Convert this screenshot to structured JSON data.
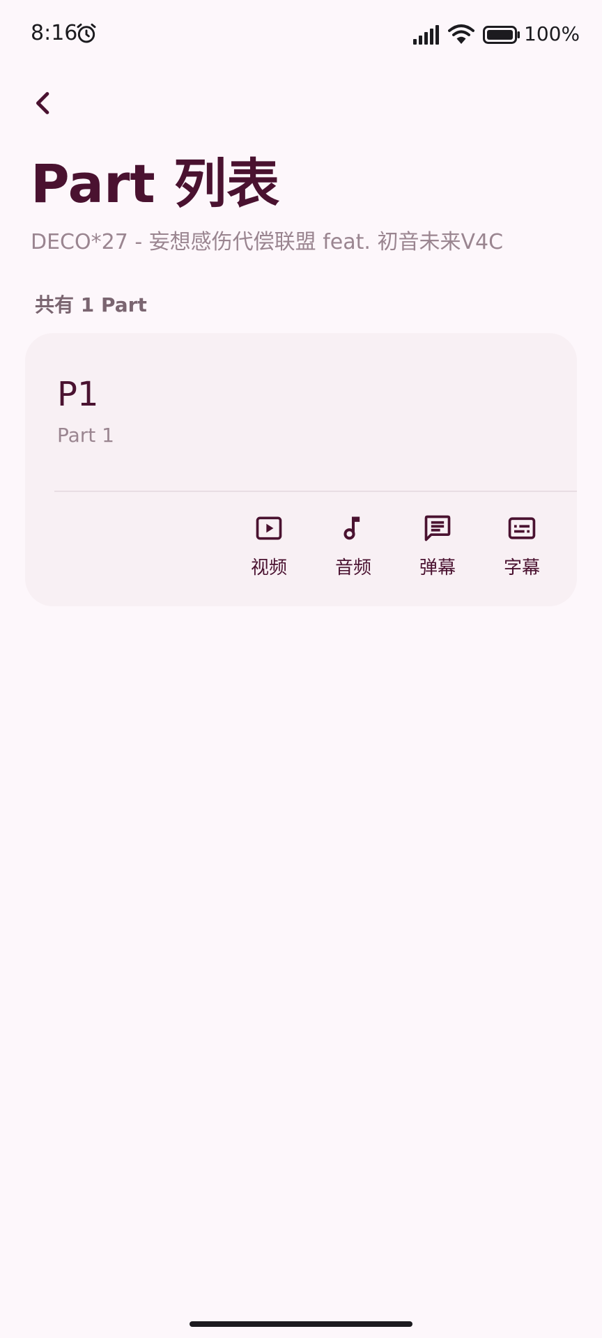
{
  "status_bar": {
    "time": "8:16",
    "battery": "100%"
  },
  "header": {
    "title": "Part 列表",
    "subtitle": "DECO*27 - 妄想感伤代偿联盟 feat. 初音未来V4C"
  },
  "list": {
    "count_label": "共有 1 Part",
    "parts": [
      {
        "title": "P1",
        "name": "Part 1",
        "actions": [
          {
            "label": "视频",
            "icon": "video-icon"
          },
          {
            "label": "音频",
            "icon": "music-note-icon"
          },
          {
            "label": "弹幕",
            "icon": "danmaku-icon"
          },
          {
            "label": "字幕",
            "icon": "subtitles-icon"
          }
        ]
      }
    ]
  },
  "colors": {
    "background": "#fdf7fb",
    "card": "#f8f0f4",
    "primary": "#4a1230",
    "secondary_text": "#9a8590"
  }
}
